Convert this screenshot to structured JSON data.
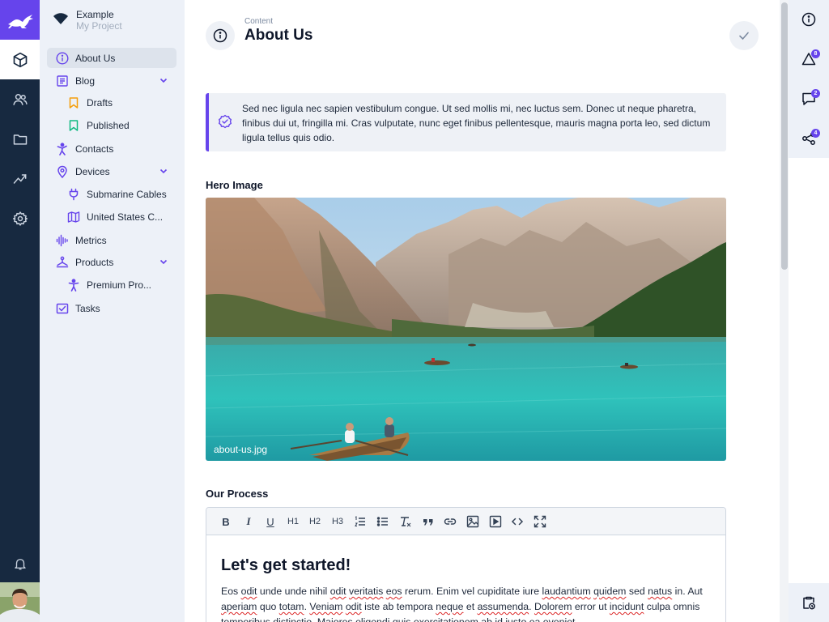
{
  "project": {
    "name": "Example",
    "subtitle": "My Project"
  },
  "nav": [
    {
      "label": "About Us",
      "icon": "info-circle-icon",
      "active": true
    },
    {
      "label": "Blog",
      "icon": "document-icon",
      "expanded": true
    },
    {
      "label": "Drafts",
      "icon": "bookmark-icon",
      "child": true
    },
    {
      "label": "Published",
      "icon": "bookmark-icon",
      "child": true
    },
    {
      "label": "Contacts",
      "icon": "person-icon"
    },
    {
      "label": "Devices",
      "icon": "map-pin-icon",
      "expanded": true
    },
    {
      "label": "Submarine Cables",
      "icon": "plug-icon",
      "child": true
    },
    {
      "label": "United States C...",
      "icon": "map-icon",
      "child": true
    },
    {
      "label": "Metrics",
      "icon": "waveform-icon"
    },
    {
      "label": "Products",
      "icon": "stand-icon",
      "expanded": true
    },
    {
      "label": "Premium Pro...",
      "icon": "person-icon",
      "child": true
    },
    {
      "label": "Tasks",
      "icon": "checkbox-icon"
    }
  ],
  "header": {
    "breadcrumb": "Content",
    "title": "About Us"
  },
  "callout": {
    "text": "Sed nec ligula nec sapien vestibulum congue. Ut sed mollis mi, nec luctus sem. Donec ut neque pharetra, finibus dui ut, fringilla mi. Cras vulputate, nunc eget finibus pellentesque, mauris magna porta leo, sed dictum ligula tellus quis odio."
  },
  "hero": {
    "label": "Hero Image",
    "filename": "about-us.jpg"
  },
  "process": {
    "label": "Our Process",
    "toolbar": [
      "B",
      "I",
      "U",
      "H1",
      "H2",
      "H3"
    ],
    "heading": "Let's get started!",
    "paragraph": {
      "p1": "Eos ",
      "w1": "odit",
      "p2": " unde unde nihil ",
      "w2": "odit",
      "p3": " ",
      "w3": "veritatis",
      "p4": " ",
      "w4": "eos",
      "p5": " rerum. Enim vel cupiditate iure ",
      "w5": "laudantium",
      "p6": " ",
      "w6": "quidem",
      "p7": " sed ",
      "w7": "natus",
      "p8": " in. Aut ",
      "w8": "aperiam",
      "p9": " quo ",
      "w9": "totam",
      "p10": ". ",
      "w10": "Veniam",
      "p11": " ",
      "w11": "odit",
      "p12": " iste ab tempora ",
      "w12": "neque",
      "p13": " et ",
      "w13": "assumenda",
      "p14": ". ",
      "w14": "Dolorem",
      "p15": " error ut ",
      "w15": "incidunt",
      "p16": " culpa omnis temporibus distinctio. Maiores eligendi quis exercitationem ab id iusto ea eveniet."
    }
  },
  "right_rail": {
    "badges": {
      "alerts": "8",
      "comments": "2",
      "shares": "4"
    }
  },
  "colors": {
    "accent": "#6644ec",
    "rail": "#172940",
    "sidebar": "#edf1f8"
  }
}
